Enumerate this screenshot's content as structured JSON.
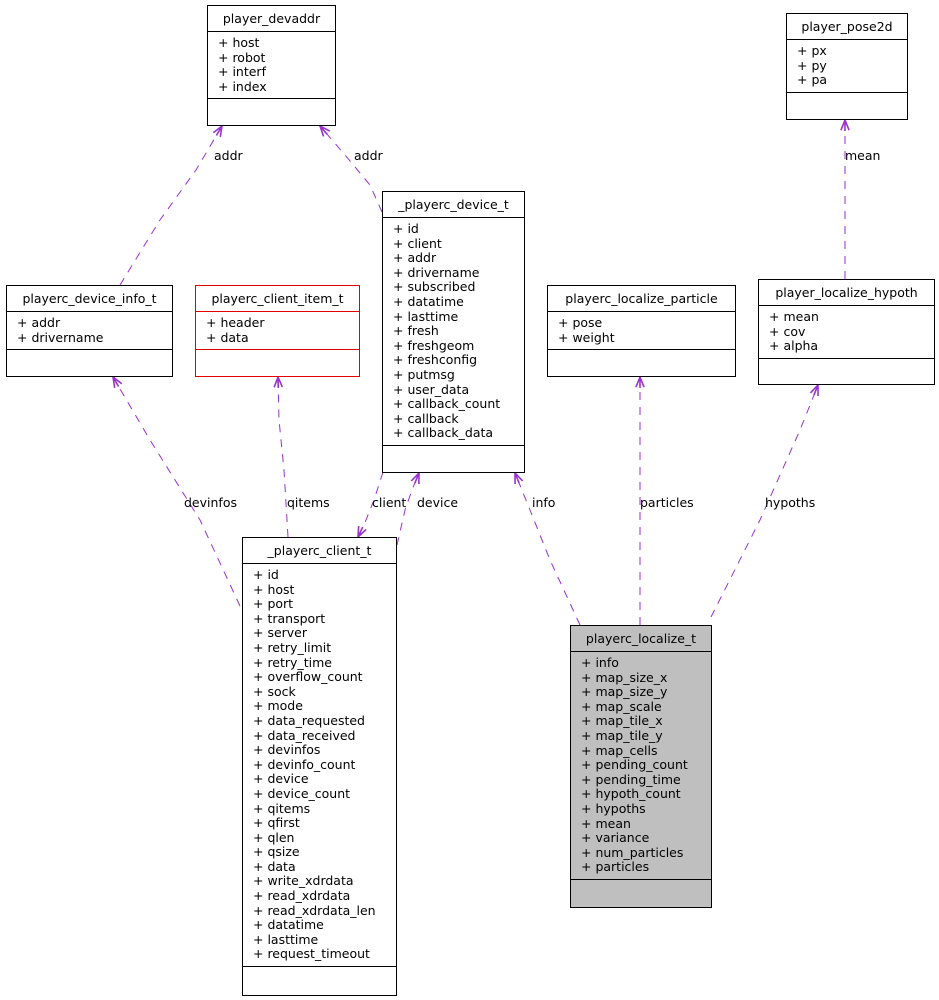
{
  "diagram": {
    "type": "collaboration-diagram",
    "edge_color": "#9a32cd",
    "highlight_fill": "#bfbfbf",
    "incomplete_border": "#e00000"
  },
  "classes": {
    "player_devaddr": {
      "name": "player_devaddr",
      "attributes": [
        "+ host",
        "+ robot",
        "+ interf",
        "+ index"
      ]
    },
    "player_pose2d": {
      "name": "player_pose2d",
      "attributes": [
        "+ px",
        "+ py",
        "+ pa"
      ]
    },
    "playerc_device_t": {
      "name": "_playerc_device_t",
      "attributes": [
        "+ id",
        "+ client",
        "+ addr",
        "+ drivername",
        "+ subscribed",
        "+ datatime",
        "+ lasttime",
        "+ fresh",
        "+ freshgeom",
        "+ freshconfig",
        "+ putmsg",
        "+ user_data",
        "+ callback_count",
        "+ callback",
        "+ callback_data"
      ]
    },
    "playerc_device_info_t": {
      "name": "playerc_device_info_t",
      "attributes": [
        "+ addr",
        "+ drivername"
      ]
    },
    "playerc_client_item_t": {
      "name": "playerc_client_item_t",
      "attributes": [
        "+ header",
        "+ data"
      ]
    },
    "playerc_localize_particle": {
      "name": "playerc_localize_particle",
      "attributes": [
        "+ pose",
        "+ weight"
      ]
    },
    "player_localize_hypoth": {
      "name": "player_localize_hypoth",
      "attributes": [
        "+ mean",
        "+ cov",
        "+ alpha"
      ]
    },
    "playerc_client_t": {
      "name": "_playerc_client_t",
      "attributes": [
        "+ id",
        "+ host",
        "+ port",
        "+ transport",
        "+ server",
        "+ retry_limit",
        "+ retry_time",
        "+ overflow_count",
        "+ sock",
        "+ mode",
        "+ data_requested",
        "+ data_received",
        "+ devinfos",
        "+ devinfo_count",
        "+ device",
        "+ device_count",
        "+ qitems",
        "+ qfirst",
        "+ qlen",
        "+ qsize",
        "+ data",
        "+ write_xdrdata",
        "+ read_xdrdata",
        "+ read_xdrdata_len",
        "+ datatime",
        "+ lasttime",
        "+ request_timeout"
      ]
    },
    "playerc_localize_t": {
      "name": "playerc_localize_t",
      "attributes": [
        "+ info",
        "+ map_size_x",
        "+ map_size_y",
        "+ map_scale",
        "+ map_tile_x",
        "+ map_tile_y",
        "+ map_cells",
        "+ pending_count",
        "+ pending_time",
        "+ hypoth_count",
        "+ hypoths",
        "+ mean",
        "+ variance",
        "+ num_particles",
        "+ particles"
      ]
    }
  },
  "edges": [
    {
      "from": "playerc_device_info_t",
      "to": "player_devaddr",
      "label": "addr"
    },
    {
      "from": "playerc_device_t",
      "to": "player_devaddr",
      "label": "addr"
    },
    {
      "from": "player_localize_hypoth",
      "to": "player_pose2d",
      "label": "mean"
    },
    {
      "from": "playerc_client_t",
      "to": "playerc_device_info_t",
      "label": "devinfos"
    },
    {
      "from": "playerc_client_t",
      "to": "playerc_client_item_t",
      "label": "qitems"
    },
    {
      "from": "playerc_device_t",
      "to": "playerc_client_t",
      "label": "client"
    },
    {
      "from": "playerc_client_t",
      "to": "playerc_device_t",
      "label": "device"
    },
    {
      "from": "playerc_localize_t",
      "to": "playerc_device_t",
      "label": "info"
    },
    {
      "from": "playerc_localize_t",
      "to": "playerc_localize_particle",
      "label": "particles"
    },
    {
      "from": "playerc_localize_t",
      "to": "player_localize_hypoth",
      "label": "hypoths"
    }
  ]
}
